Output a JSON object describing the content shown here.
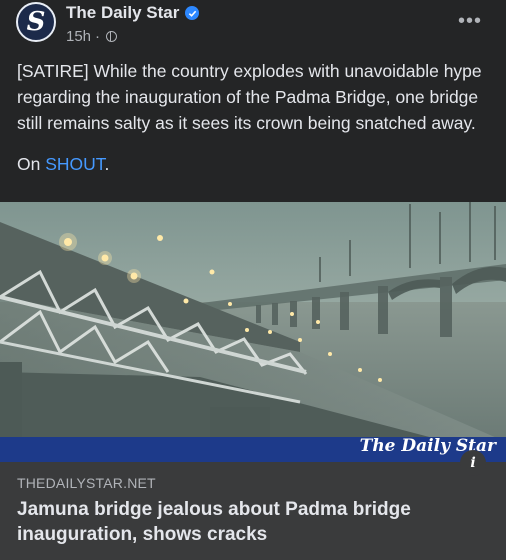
{
  "post": {
    "page_name": "The Daily Star",
    "verified_icon": "verified-badge-icon",
    "time": "15h",
    "separator": "·",
    "audience_icon": "globe-icon",
    "more_label": "•••",
    "text": "[SATIRE] While the country explodes with unavoidable hype regarding the inauguration of the Padma Bridge, one bridge still remains salty as it sees its crown being snatched away.",
    "on_prefix": "On ",
    "on_link": "SHOUT",
    "on_suffix": "."
  },
  "avatar": {
    "glyph": "S"
  },
  "image": {
    "watermark": "The Daily Star",
    "info_label": "i"
  },
  "link_preview": {
    "domain": "THEDAILYSTAR.NET",
    "headline": "Jamuna bridge jealous about Padma bridge inauguration, shows cracks"
  },
  "colors": {
    "background": "#242526",
    "link": "#4599ff",
    "card": "#3a3b3c",
    "verified": "#2d88ff",
    "image_band": "#1d3a8a"
  }
}
